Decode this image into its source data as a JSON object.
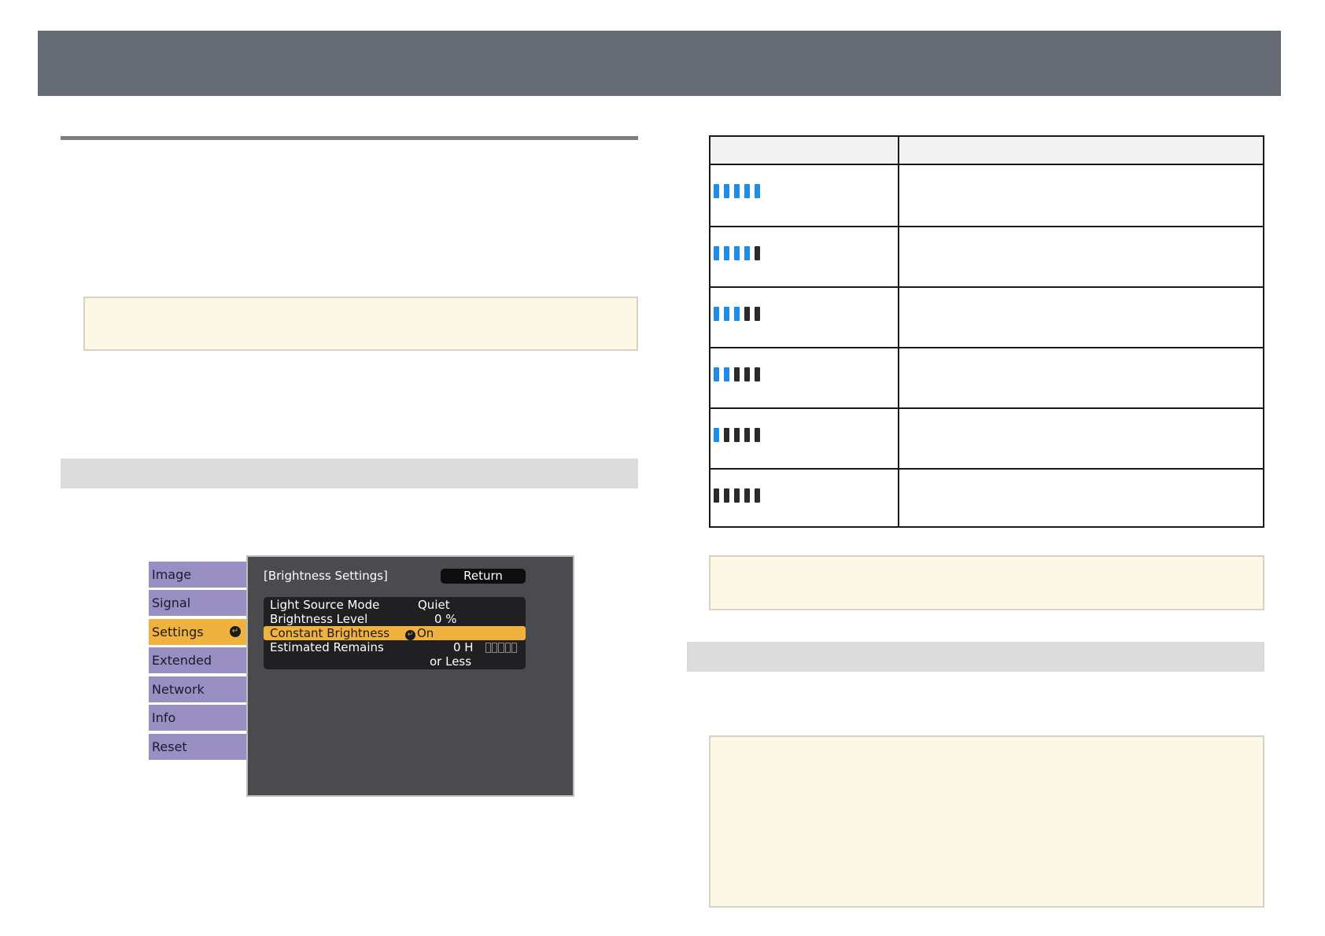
{
  "colors": {
    "lit": "#1e8de8",
    "unlit": "#2a2a2a"
  },
  "menu": {
    "tabs": [
      {
        "label": "Image"
      },
      {
        "label": "Signal"
      },
      {
        "label": "Settings"
      },
      {
        "label": "Extended"
      },
      {
        "label": "Network"
      },
      {
        "label": "Info"
      },
      {
        "label": "Reset"
      }
    ],
    "active_tab": "Settings",
    "title": "[Brightness Settings]",
    "return_label": "Return",
    "rows": {
      "light_source_mode": {
        "label": "Light Source Mode",
        "value": "Quiet"
      },
      "brightness_level": {
        "label": "Brightness Level",
        "value": "0 %"
      },
      "constant_brightness": {
        "label": "Constant Brightness",
        "value": "On"
      },
      "estimated_remains": {
        "label": "Estimated Remains",
        "value": "0 H",
        "value2": "or Less"
      }
    }
  },
  "indicator_table": {
    "rows": [
      {
        "lit_segments": 5
      },
      {
        "lit_segments": 4
      },
      {
        "lit_segments": 3
      },
      {
        "lit_segments": 2
      },
      {
        "lit_segments": 1
      },
      {
        "lit_segments": 0
      }
    ]
  }
}
